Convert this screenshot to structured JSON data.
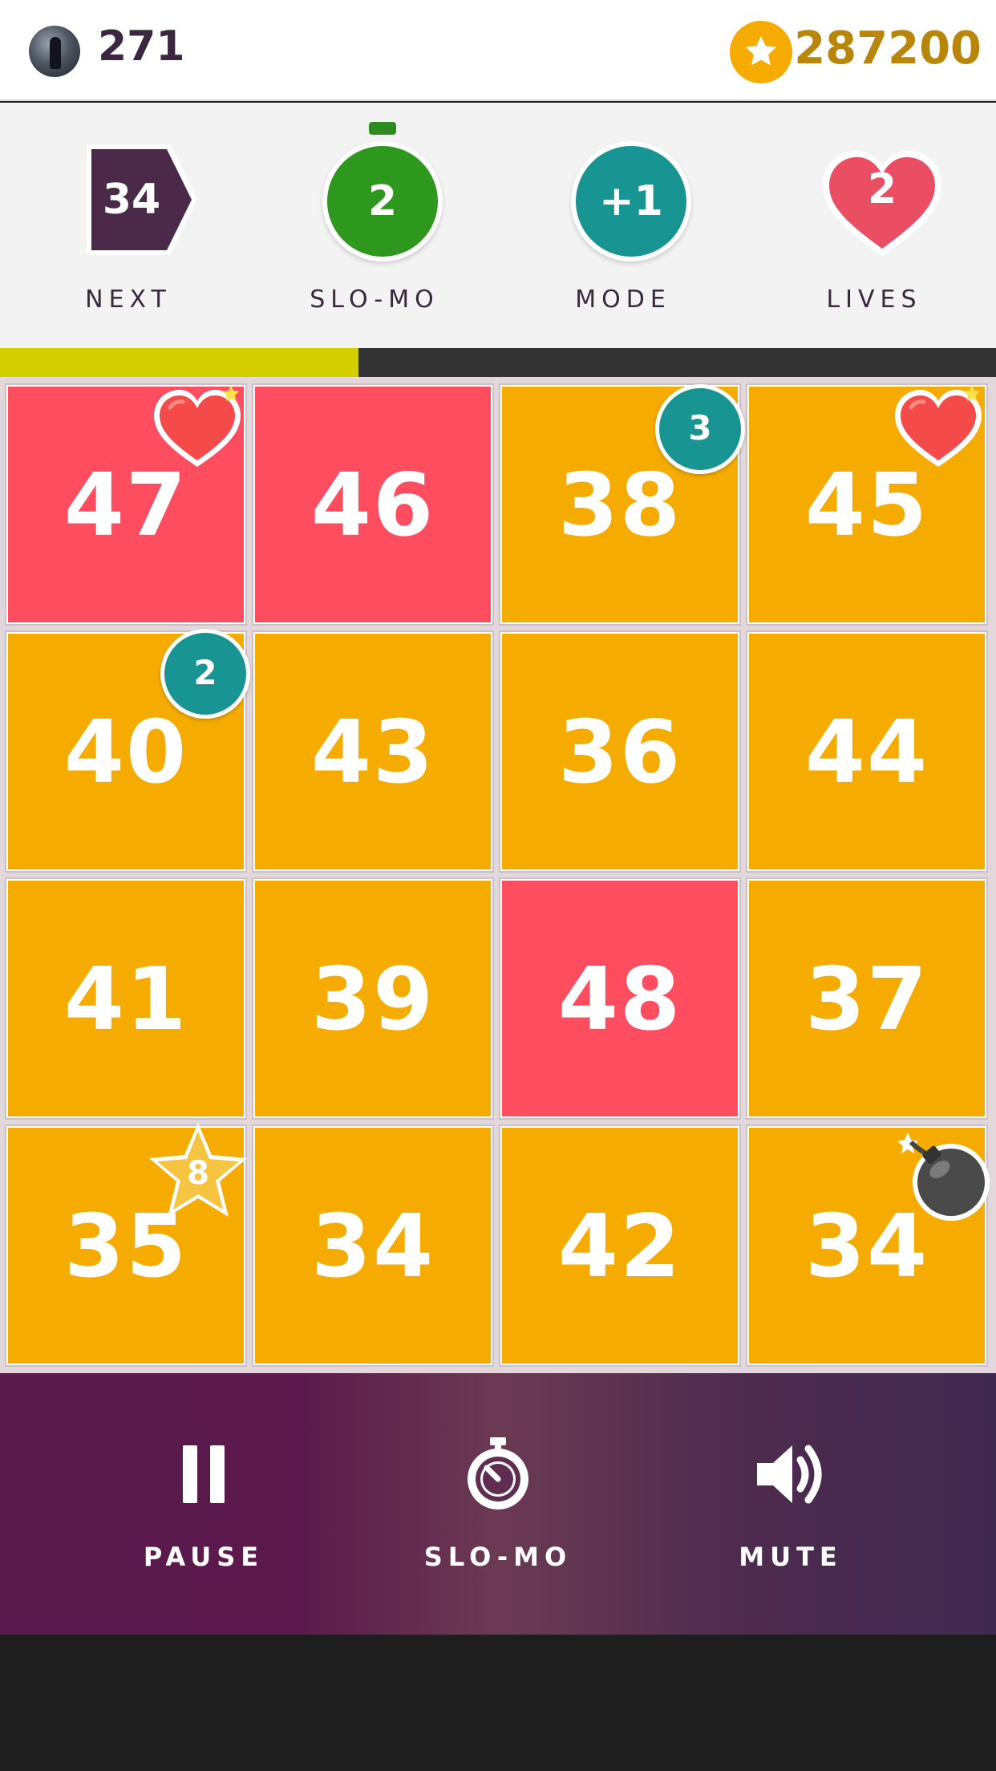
{
  "header": {
    "level": "271",
    "coins": "287200"
  },
  "status": {
    "next": {
      "value": "34",
      "label": "NEXT"
    },
    "slomo": {
      "value": "2",
      "label": "SLO-MO"
    },
    "mode": {
      "value": "+1",
      "label": "MODE"
    },
    "lives": {
      "value": "2",
      "label": "LIVES"
    }
  },
  "progress": {
    "fraction": 0.36
  },
  "board": {
    "tiles": [
      {
        "value": "47",
        "color": "#ff4d60"
      },
      {
        "value": "46",
        "color": "#ff4d60"
      },
      {
        "value": "38",
        "color": "#f5ab00",
        "badge": "3"
      },
      {
        "value": "45",
        "color": "#f5ab00"
      },
      {
        "value": "40",
        "color": "#f5ab00",
        "badge": "2"
      },
      {
        "value": "43",
        "color": "#f5ab00"
      },
      {
        "value": "36",
        "color": "#f5ab00"
      },
      {
        "value": "44",
        "color": "#f5ab00"
      },
      {
        "value": "41",
        "color": "#f5ab00"
      },
      {
        "value": "39",
        "color": "#f5ab00"
      },
      {
        "value": "48",
        "color": "#ff4d60"
      },
      {
        "value": "37",
        "color": "#f5ab00"
      },
      {
        "value": "35",
        "color": "#f5ab00",
        "star": "8"
      },
      {
        "value": "34",
        "color": "#f5ab00"
      },
      {
        "value": "42",
        "color": "#f5ab00"
      },
      {
        "value": "34",
        "color": "#f5ab00"
      }
    ]
  },
  "controls": {
    "pause_label": "PAUSE",
    "slomo_label": "SLO-MO",
    "mute_label": "MUTE"
  },
  "colors": {
    "orange": "#f5ab00",
    "red": "#ff4d60",
    "teal": "#189493",
    "green": "#2e971e",
    "purple": "#4a2a48"
  },
  "icons": [
    "avatar",
    "star-coin-icon",
    "heart-icon",
    "bomb-icon",
    "star-icon",
    "pause-icon",
    "stopwatch-icon",
    "speaker-icon"
  ]
}
